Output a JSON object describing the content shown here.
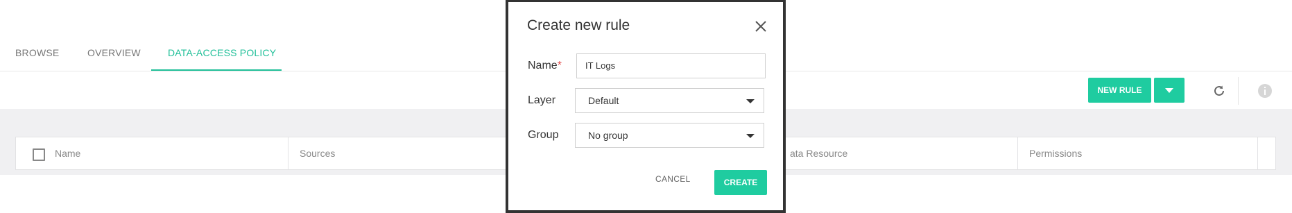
{
  "tabs": [
    {
      "label": "BROWSE"
    },
    {
      "label": "OVERVIEW"
    },
    {
      "label": "DATA-ACCESS POLICY"
    }
  ],
  "toolbar": {
    "new_rule_label": "NEW RULE",
    "dropdown_icon": "caret-down-icon",
    "refresh_icon": "refresh-icon",
    "info_icon": "info-icon"
  },
  "table": {
    "columns": [
      "Name",
      "Sources",
      "ata Resource",
      "Permissions"
    ]
  },
  "modal": {
    "title": "Create new rule",
    "name_label": "Name",
    "required_mark": "*",
    "name_value": "IT Logs",
    "layer_label": "Layer",
    "layer_value": "Default",
    "group_label": "Group",
    "group_value": "No group",
    "cancel_label": "CANCEL",
    "create_label": "CREATE"
  },
  "colors": {
    "accent": "#1fcca0",
    "active_tab": "#1fbf98",
    "required": "#e24b4b"
  }
}
